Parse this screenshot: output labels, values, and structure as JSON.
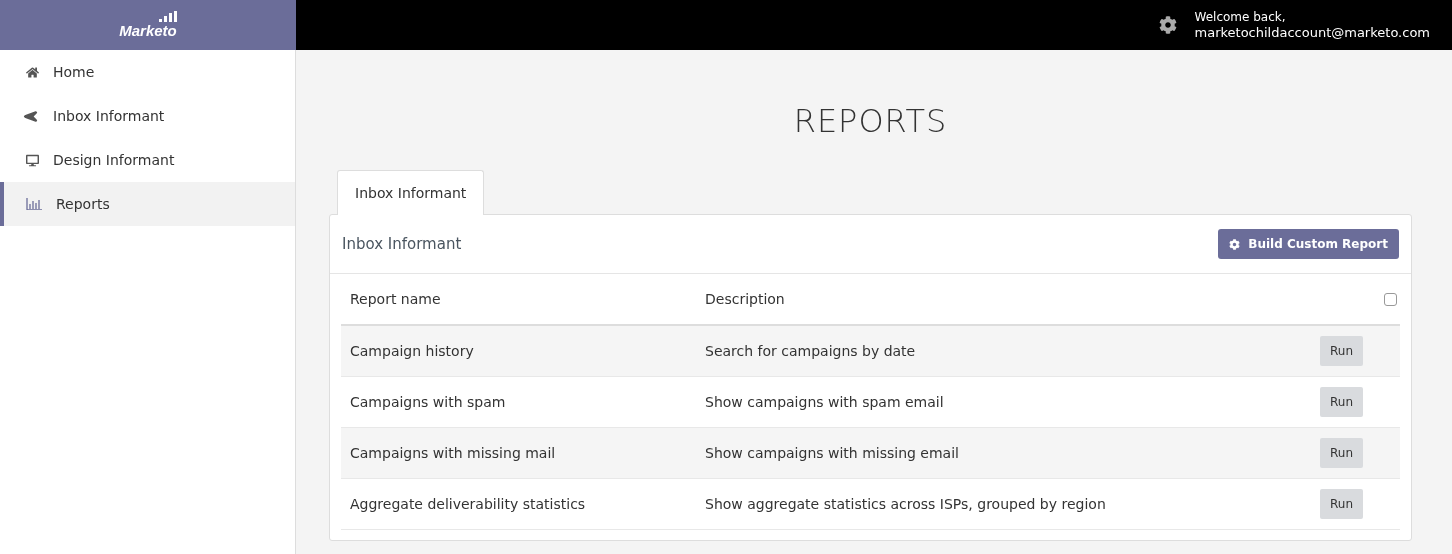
{
  "logo": {
    "text": "Marketo"
  },
  "header": {
    "greeting": "Welcome back,",
    "email": "marketochildaccount@marketo.com"
  },
  "sidebar": {
    "items": [
      {
        "label": "Home",
        "selected": false
      },
      {
        "label": "Inbox Informant",
        "selected": false
      },
      {
        "label": "Design Informant",
        "selected": false
      },
      {
        "label": "Reports",
        "selected": true
      }
    ]
  },
  "page_title": "REPORTS",
  "tabs": [
    {
      "label": "Inbox Informant",
      "selected": true
    }
  ],
  "panel": {
    "title": "Inbox Informant",
    "action": "Build Custom Report"
  },
  "table": {
    "columns": [
      "Report name",
      "Description"
    ],
    "select_all": {
      "checked": false
    },
    "rows": [
      {
        "name": "Campaign history",
        "description": "Search for campaigns by date",
        "action": "Run"
      },
      {
        "name": "Campaigns with spam",
        "description": "Show campaigns with spam email",
        "action": "Run"
      },
      {
        "name": "Campaigns with missing mail",
        "description": "Show campaigns with missing email",
        "action": "Run"
      },
      {
        "name": "Aggregate deliverability statistics",
        "description": "Show aggregate statistics across ISPs, grouped by region",
        "action": "Run"
      }
    ]
  }
}
